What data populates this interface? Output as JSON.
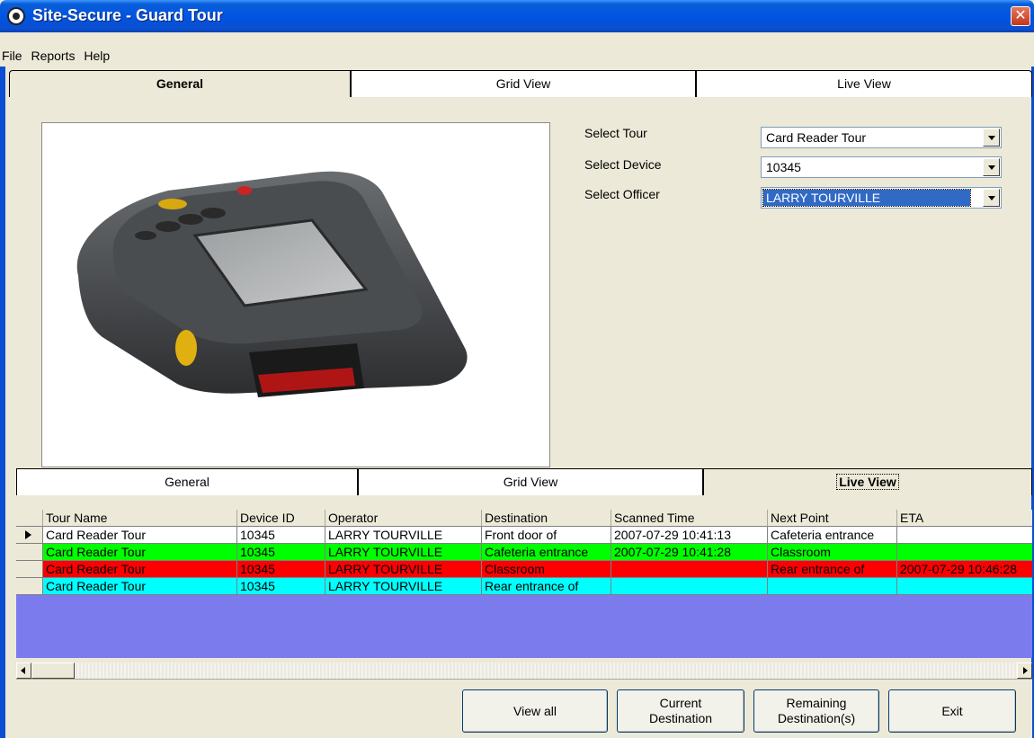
{
  "window": {
    "title": "Site-Secure - Guard Tour",
    "close_glyph": "✕"
  },
  "menu": [
    "File",
    "Reports",
    "Help"
  ],
  "top_tabs": [
    "General",
    "Grid View",
    "Live View"
  ],
  "form": {
    "tour_label": "Select Tour",
    "tour_value": "Card Reader Tour",
    "device_label": "Select Device",
    "device_value": "10345",
    "officer_label": "Select Officer",
    "officer_value": "LARRY TOURVILLE"
  },
  "bottom_tabs": [
    "General",
    "Grid View",
    "Live View"
  ],
  "grid": {
    "columns": [
      "Tour Name",
      "Device ID",
      "Operator",
      "Destination",
      "Scanned Time",
      "Next Point",
      "ETA"
    ],
    "rows": [
      {
        "tour": "Card Reader Tour",
        "device": "10345",
        "operator": "LARRY TOURVILLE",
        "destination": "Front door of",
        "scanned": "2007-07-29 10:41:13",
        "next": "Cafeteria entrance",
        "eta": "",
        "color": "#ffffff"
      },
      {
        "tour": "Card Reader Tour",
        "device": "10345",
        "operator": "LARRY TOURVILLE",
        "destination": "Cafeteria entrance",
        "scanned": "2007-07-29 10:41:28",
        "next": "Classroom",
        "eta": "",
        "color": "#00ff00"
      },
      {
        "tour": "Card Reader Tour",
        "device": "10345",
        "operator": "LARRY TOURVILLE",
        "destination": "Classroom",
        "scanned": "",
        "next": "Rear entrance of",
        "eta": "2007-07-29 10:46:28",
        "color": "#ff0000"
      },
      {
        "tour": "Card Reader Tour",
        "device": "10345",
        "operator": "LARRY TOURVILLE",
        "destination": "Rear entrance of",
        "scanned": "",
        "next": "",
        "eta": "",
        "color": "#00ffff"
      }
    ]
  },
  "buttons": {
    "view_all": "View all",
    "current_destination": "Current\nDestination",
    "remaining_destinations": "Remaining\nDestination(s)",
    "exit": "Exit"
  }
}
